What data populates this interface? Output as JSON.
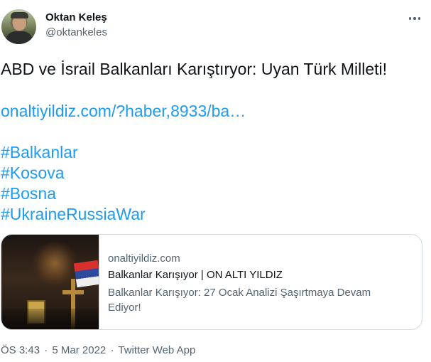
{
  "author": {
    "name": "Oktan Keleş",
    "handle": "@oktankeles",
    "avatar_icon": "profile-photo"
  },
  "more_icon": "three-dots-icon",
  "tweet": {
    "text": "ABD ve İsrail Balkanları Karıştıryor: Uyan Türk Milleti!",
    "link": "onaltiyildiz.com/?haber,8933/ba…",
    "hashtags": [
      "#Balkanlar",
      "#Kosova",
      "#Bosna",
      "#UkraineRussiaWar"
    ]
  },
  "card": {
    "domain": "onaltiyildiz.com",
    "title": "Balkanlar Karışıyor | ON ALTI YILDIZ",
    "description": "Balkanlar Karışıyor: 27 Ocak Analizi Şaşırtmaya Devam Ediyor!"
  },
  "meta": {
    "time": "ÖS 3:43",
    "separator": "·",
    "date": "5 Mar 2022",
    "source": "Twitter Web App"
  },
  "colors": {
    "link": "#1d9bf0",
    "secondary_text": "#536471",
    "border": "#cfd9de"
  }
}
